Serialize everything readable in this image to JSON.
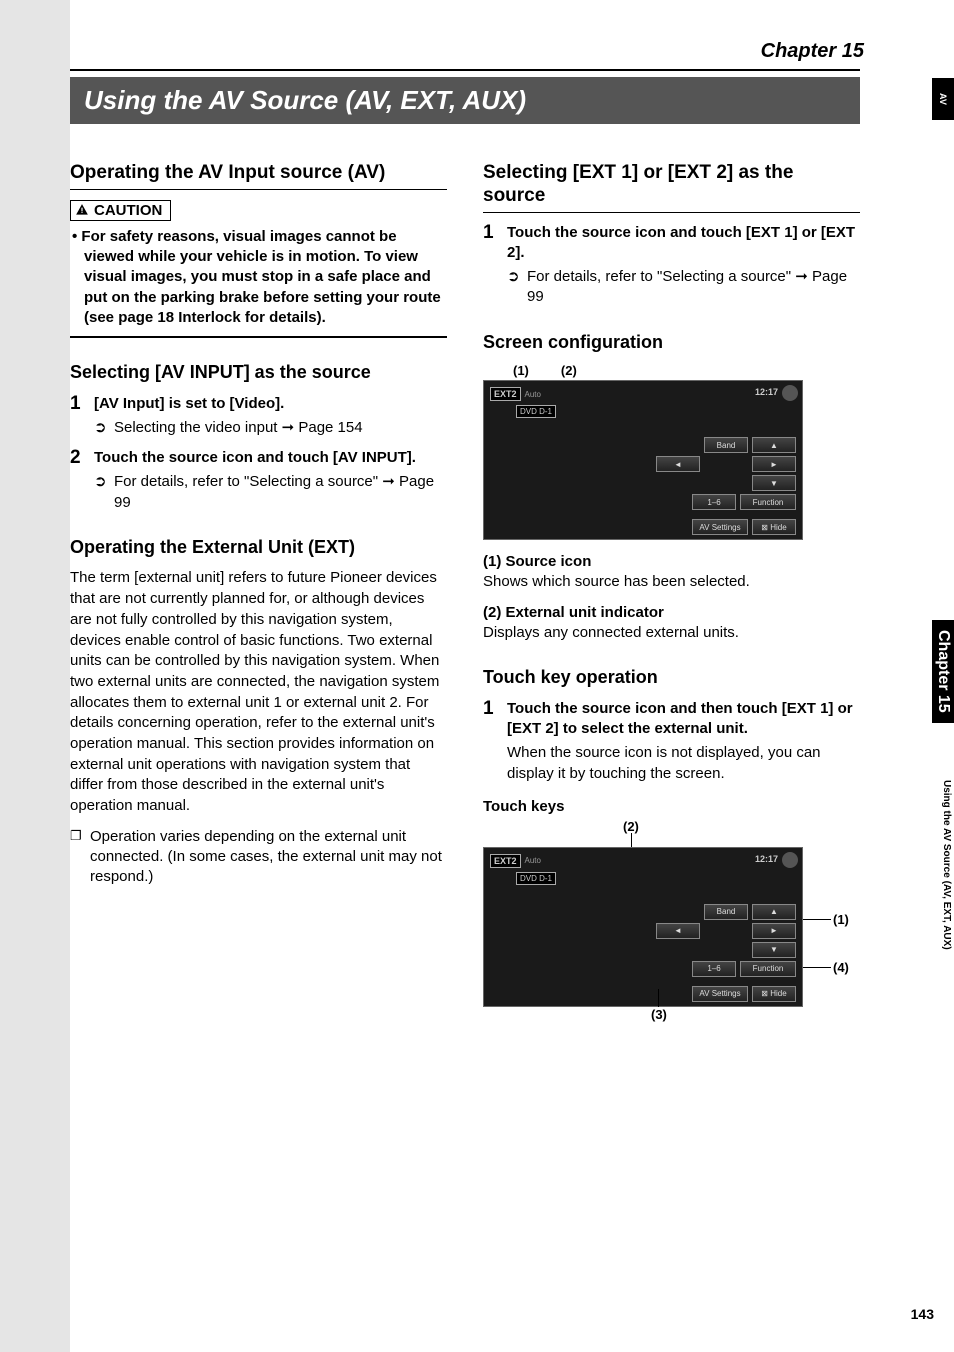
{
  "chapter_label": "Chapter 15",
  "title": "Using the AV Source (AV, EXT, AUX)",
  "side": {
    "tab": "AV",
    "chapter": "Chapter 15",
    "title": "Using the AV Source (AV, EXT, AUX)"
  },
  "page_number": "143",
  "left": {
    "section1": "Operating the AV Input source (AV)",
    "caution_label": "CAUTION",
    "caution_text": "For safety reasons, visual images cannot be viewed while your vehicle is in motion. To view visual images, you must stop in a safe place and put on the parking brake before setting your route (see page 18 Interlock for details).",
    "section2": "Selecting [AV INPUT] as the source",
    "step1": {
      "num": "1",
      "bold": "[AV Input] is set to [Video].",
      "sub_sym": "➲",
      "sub_text": "Selecting the video input ➞ Page 154"
    },
    "step2": {
      "num": "2",
      "bold": "Touch the source icon and touch [AV INPUT].",
      "sub_sym": "➲",
      "sub_text": "For details, refer to \"Selecting a source\" ➞ Page 99"
    },
    "section3": "Operating the External Unit (EXT)",
    "ext_para": "The term [external unit] refers to future Pioneer devices that are not currently planned for, or although devices are not fully controlled by this navigation system, devices enable control of basic functions. Two external units can be controlled by this navigation system. When two external units are connected, the navigation system allocates them to external unit 1 or external unit 2. For details concerning operation, refer to the external unit's operation manual. This section provides information on external unit operations with navigation system that differ from those described in the external unit's operation manual.",
    "ext_bullet_sym": "❐",
    "ext_bullet": "Operation varies depending on the external unit connected. (In some cases, the external unit may not respond.)"
  },
  "right": {
    "section1": "Selecting [EXT 1] or [EXT 2] as the source",
    "step1": {
      "num": "1",
      "bold": "Touch the source icon and touch [EXT 1] or [EXT 2].",
      "sub_sym": "➲",
      "sub_text": "For details, refer to \"Selecting a source\" ➞ Page 99"
    },
    "section2": "Screen configuration",
    "callout1": "(1)",
    "callout2": "(2)",
    "shot": {
      "ext2": "EXT2",
      "auto": "Auto",
      "dvd": "DVD D-1",
      "clock": "12:17",
      "band": "Band",
      "up": "▲",
      "left": "◄",
      "right": "►",
      "down": "▼",
      "btn16": "1–6",
      "func": "Function",
      "avset": "AV Settings",
      "hide": "⊠ Hide"
    },
    "desc1_label": "(1) Source icon",
    "desc1_text": "Shows which source has been selected.",
    "desc2_label": "(2) External unit indicator",
    "desc2_text": "Displays any connected external units.",
    "section3": "Touch key operation",
    "tstep1": {
      "num": "1",
      "bold": "Touch the source icon and then touch [EXT 1] or [EXT 2] to select the external unit.",
      "text": "When the source icon is not displayed, you can display it by touching the screen."
    },
    "touch_keys_label": "Touch keys",
    "ptr1": "(1)",
    "ptr2": "(2)",
    "ptr3": "(3)",
    "ptr4": "(4)"
  }
}
